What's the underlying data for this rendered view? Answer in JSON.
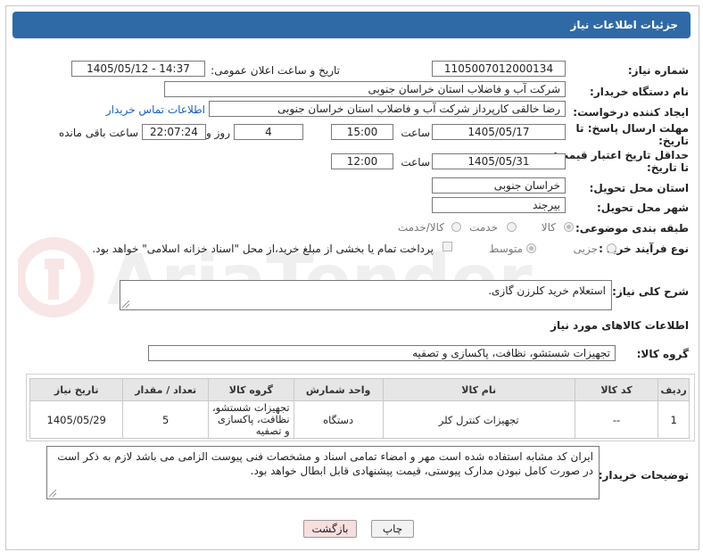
{
  "header": {
    "title": "جزئیات اطلاعات نیاز"
  },
  "fields": {
    "need_number_label": "شماره نیاز:",
    "need_number": "1105007012000134",
    "announce_label": "تاریخ و ساعت اعلان عمومی:",
    "announce_value": "1405/05/12 - 14:37",
    "buyer_org_label": "نام دستگاه خریدار:",
    "buyer_org": "شرکت آب و فاضلاب استان خراسان جنوبی",
    "creator_label": "ایجاد کننده درخواست:",
    "creator": "رضا خالقی کارپرداز شرکت آب و فاضلاب استان خراسان جنوبی",
    "contact_link": "اطلاعات تماس خریدار",
    "deadline_label_1": "مهلت ارسال پاسخ: تا",
    "deadline_label_2": "تاریخ:",
    "deadline_date": "1405/05/17",
    "hour_label": "ساعت",
    "deadline_time": "15:00",
    "days_value": "4",
    "days_label": "روز و",
    "remaining_time": "22:07:24",
    "remaining_label": "ساعت باقی مانده",
    "validity_label_1": "حداقل تاریخ اعتبار قیمت:",
    "validity_label_2": "تا تاریخ:",
    "validity_date": "1405/05/31",
    "validity_time": "12:00",
    "province_label": "استان محل تحویل:",
    "province": "خراسان جنوبی",
    "city_label": "شهر محل تحویل:",
    "city": "بیرجند",
    "category_label": "طبقه بندی موضوعی:",
    "category_options": [
      "کالا",
      "خدمت",
      "کالا/خدمت"
    ],
    "process_label": "نوع فرآیند خرید :",
    "process_options": [
      "جزیی",
      "متوسط"
    ],
    "payment_note": "پرداخت تمام یا بخشی از مبلغ خرید،از محل \"اسناد خزانه اسلامی\" خواهد بود."
  },
  "summary": {
    "label": "شرح کلی نیاز:",
    "text": "استعلام خرید کلرزن گازی."
  },
  "goods": {
    "section_title": "اطلاعات کالاهای مورد نیاز",
    "group_label": "گروه کالا:",
    "group_value": "تجهیزات شستشو، نظافت، پاکسازی و تصفیه",
    "columns": [
      "ردیف",
      "کد کالا",
      "نام کالا",
      "واحد شمارش",
      "گروه کالا",
      "تعداد / مقدار",
      "تاریخ نیاز"
    ],
    "rows": [
      {
        "row": "1",
        "code": "--",
        "name": "تجهیزات کنترل کلر",
        "unit": "دستگاه",
        "group": "تجهیزات شستشو، نظافت، پاکسازی و تصفیه",
        "qty": "5",
        "date": "1405/05/29"
      }
    ]
  },
  "buyer_notes": {
    "label": "توضیحات خریدار:",
    "text": "ایران کد مشابه استفاده شده است مهر و امضاء تمامی اسناد و مشخصات فنی پیوست الزامی می باشد لازم به ذکر است در صورت کامل نبودن  مدارک پیوستی،  قیمت پیشنهادی قابل ابطال خواهد بود."
  },
  "buttons": {
    "print": "چاپ",
    "back": "بازگشت"
  },
  "watermark": {
    "text": "AriaTender.neT"
  },
  "colors": {
    "header_bg": "#2f6aa6",
    "link": "#1a5fb4",
    "back_btn_bg": "#f8dede"
  }
}
